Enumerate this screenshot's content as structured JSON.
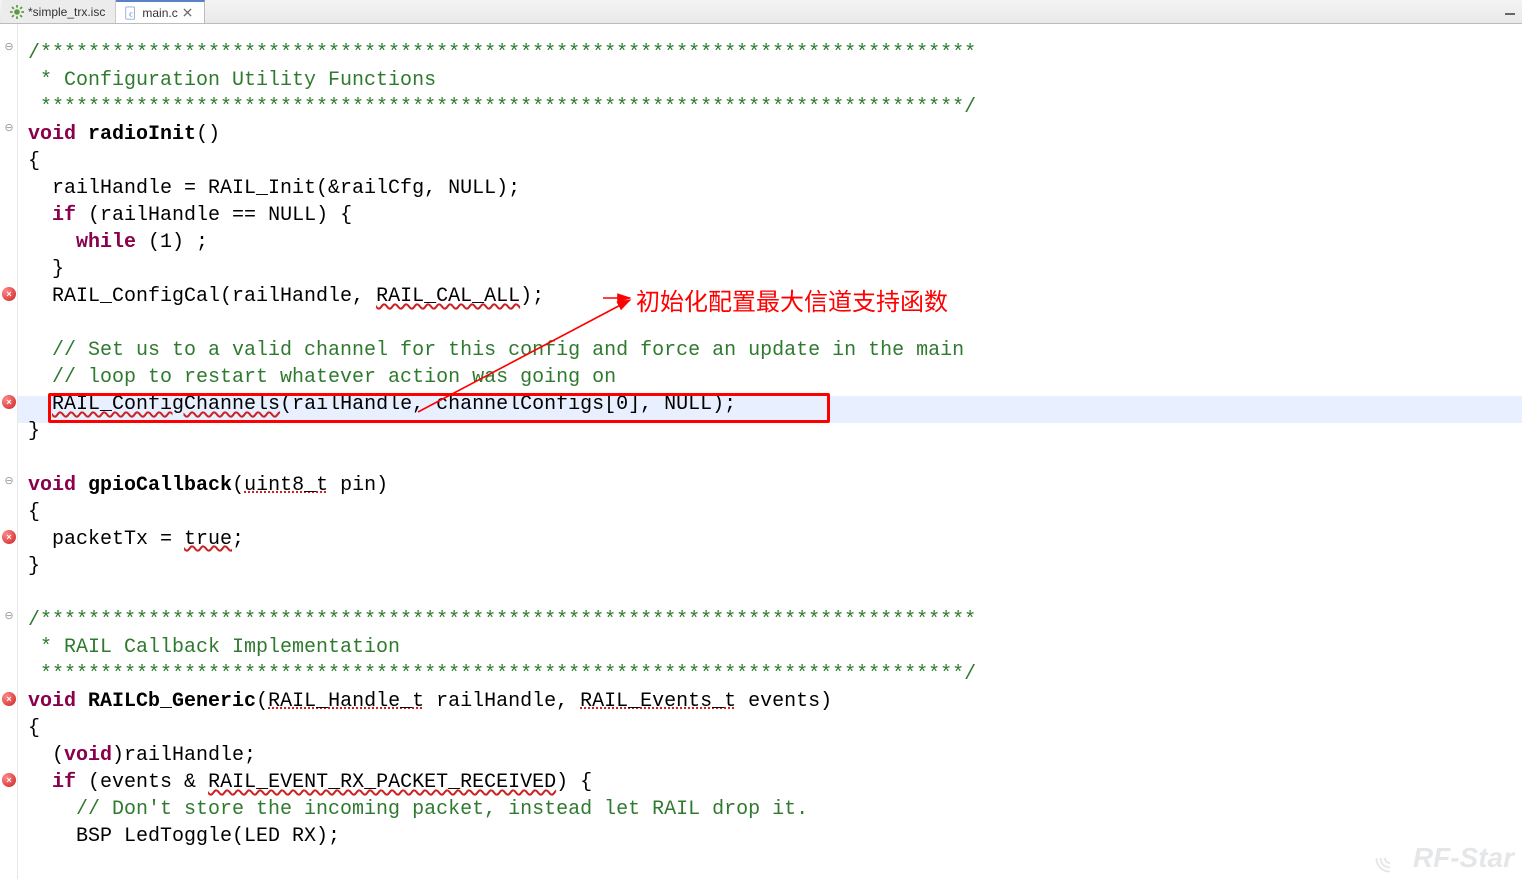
{
  "tabs": [
    {
      "label": "*simple_trx.isc",
      "active": false,
      "dirty": true,
      "icon": "gear-icon"
    },
    {
      "label": "main.c",
      "active": true,
      "dirty": false,
      "icon": "cfile-icon"
    }
  ],
  "annotation": {
    "text": "初始化配置最大信道支持函数"
  },
  "watermark": {
    "text": "RF-Star"
  },
  "code": {
    "comment_header1_stars": "/******************************************************************************",
    "comment_header1_body": " * Configuration Utility Functions",
    "comment_header1_end": " *****************************************************************************/",
    "fn1_sig_void": "void",
    "fn1_name": "radioInit",
    "fn1_open": "()",
    "line_handle_assign": "  railHandle = RAIL_Init(&railCfg, NULL);",
    "line_if_null_open": "if",
    "line_if_null_rest": " (railHandle == NULL) {",
    "line_while_kw": "while",
    "line_while_rest": " (1) ;",
    "line_if_close": "  }",
    "line_configcal_pre": "  RAIL_ConfigCal(railHandle, ",
    "line_configcal_sym": "RAIL_CAL_ALL",
    "line_configcal_post": ");",
    "cmt_set1": "  // Set us to a valid channel for this config and force an update in the main",
    "cmt_set2": "  // loop to restart whatever action was going on",
    "line_configchannels_fn": "RAIL_ConfigChannels",
    "line_configchannels_args": "(railHandle, channelConfigs[0], NULL);",
    "fn1_close": "}",
    "fn2_sig_void": "void",
    "fn2_name": "gpioCallback",
    "fn2_args_type": "uint8_t",
    "fn2_args_rest": " pin)",
    "fn2_body_line": "  packetTx = ",
    "fn2_body_true": "true",
    "fn2_body_semi": ";",
    "fn2_close": "}",
    "comment_header2_stars": "/******************************************************************************",
    "comment_header2_body": " * RAIL Callback Implementation",
    "comment_header2_end": " *****************************************************************************/",
    "fn3_sig_void": "void",
    "fn3_name": "RAILCb_Generic",
    "fn3_arg1_type": "RAIL_Handle_t",
    "fn3_arg1_rest": " railHandle, ",
    "fn3_arg2_type": "RAIL_Events_t",
    "fn3_arg2_rest": " events)",
    "fn3_line_cast_void": "void",
    "fn3_line_cast_rest": ")railHandle;",
    "fn3_if_kw": "if",
    "fn3_if_rest_pre": " (events & ",
    "fn3_if_sym": "RAIL_EVENT_RX_PACKET_RECEIVED",
    "fn3_if_rest_post": ") {",
    "fn3_cmt": "    // Don't store the incoming packet, instead let RAIL drop it.",
    "fn3_led": "    BSP LedToggle(LED RX);"
  }
}
